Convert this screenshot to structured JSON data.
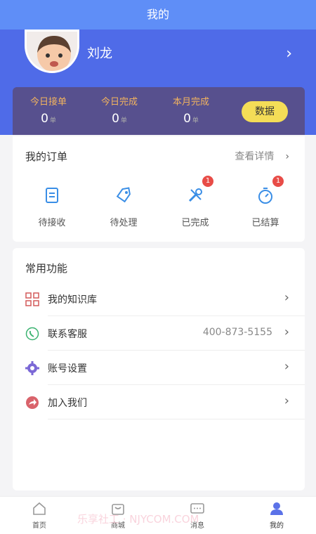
{
  "header": {
    "title": "我的"
  },
  "profile": {
    "name": "刘龙"
  },
  "stats": [
    {
      "label": "今日接单",
      "value": "0",
      "unit": "单"
    },
    {
      "label": "今日完成",
      "value": "0",
      "unit": "单"
    },
    {
      "label": "本月完成",
      "value": "0",
      "unit": "单"
    }
  ],
  "data_button": "数据",
  "orders": {
    "title": "我的订单",
    "detail": "查看详情",
    "items": [
      {
        "label": "待接收",
        "icon": "document-icon",
        "badge": ""
      },
      {
        "label": "待处理",
        "icon": "tag-icon",
        "badge": ""
      },
      {
        "label": "已完成",
        "icon": "tools-icon",
        "badge": "1"
      },
      {
        "label": "已结算",
        "icon": "stopwatch-icon",
        "badge": "1"
      }
    ]
  },
  "common": {
    "title": "常用功能",
    "items": [
      {
        "label": "我的知识库",
        "value": "",
        "icon": "grid-icon"
      },
      {
        "label": "联系客服",
        "value": "400-873-5155",
        "icon": "phone-icon"
      },
      {
        "label": "账号设置",
        "value": "",
        "icon": "gear-icon"
      },
      {
        "label": "加入我们",
        "value": "",
        "icon": "share-icon"
      }
    ]
  },
  "tabs": [
    {
      "label": "首页",
      "icon": "home-icon"
    },
    {
      "label": "商城",
      "icon": "shop-icon"
    },
    {
      "label": "消息",
      "icon": "message-icon"
    },
    {
      "label": "我的",
      "icon": "user-icon"
    }
  ],
  "watermark": "乐享社工 · NJYCOM.COM",
  "colors": {
    "header": "#5f8ef7",
    "hero": "#4f6be8",
    "stats_bg": "#57508e",
    "accent_yellow": "#f4dd57",
    "badge": "#e84c47"
  }
}
